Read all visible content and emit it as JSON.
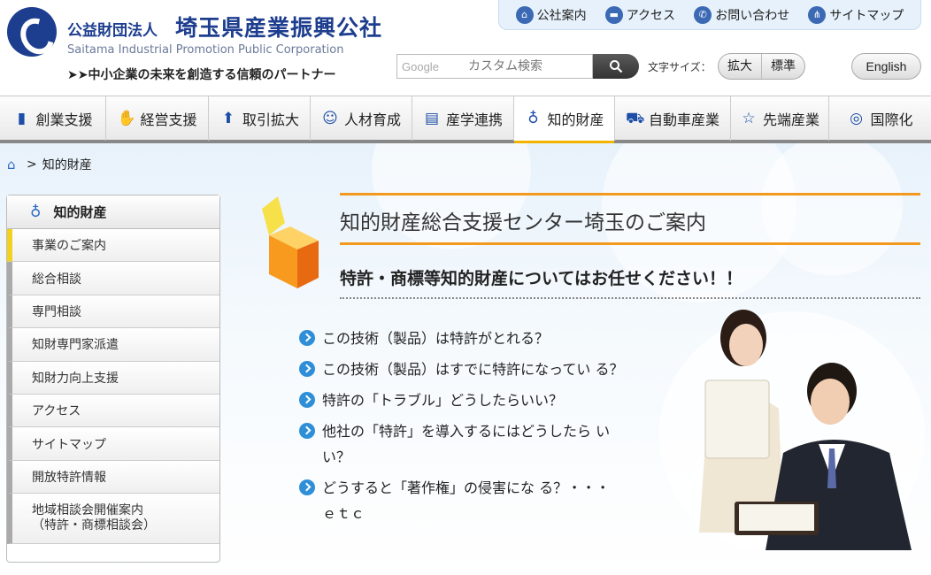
{
  "header": {
    "org_prefix": "公益財団法人",
    "org_name": "埼玉県産業振興公社",
    "org_en": "Saitama Industrial Promotion Public Corporation",
    "tagline": "➤➤中小企業の未来を創造する信頼のパートナー",
    "top_links": [
      {
        "label": "公社案内",
        "icon": "building-icon"
      },
      {
        "label": "アクセス",
        "icon": "car-icon"
      },
      {
        "label": "お問い合わせ",
        "icon": "phone-icon"
      },
      {
        "label": "サイトマップ",
        "icon": "sitemap-icon"
      }
    ],
    "search": {
      "brand": "Google",
      "placeholder": "カスタム検索"
    },
    "fontsize": {
      "label": "文字サイズ：",
      "larger": "拡大",
      "standard": "標準"
    },
    "english": "English"
  },
  "mainnav": {
    "items": [
      {
        "label": "創業支援",
        "icon": "door-icon"
      },
      {
        "label": "経営支援",
        "icon": "handshake-icon"
      },
      {
        "label": "取引拡大",
        "icon": "up-arrow-circle-icon"
      },
      {
        "label": "人材育成",
        "icon": "person-icon"
      },
      {
        "label": "産学連携",
        "icon": "book-icon"
      },
      {
        "label": "知的財産",
        "icon": "lightbulb-icon"
      },
      {
        "label": "自動車産業",
        "icon": "car-icon"
      },
      {
        "label": "先端産業",
        "icon": "star-icon"
      },
      {
        "label": "国際化",
        "icon": "globe-icon"
      }
    ],
    "active_index": 5
  },
  "breadcrumb": {
    "current": "知的財産",
    "separator": ">"
  },
  "sidebar": {
    "heading": "知的財産",
    "items": [
      {
        "label": "事業のご案内"
      },
      {
        "label": "総合相談"
      },
      {
        "label": "専門相談"
      },
      {
        "label": "知財専門家派遣"
      },
      {
        "label": "知財力向上支援"
      },
      {
        "label": "アクセス"
      },
      {
        "label": "サイトマップ"
      },
      {
        "label": "開放特許情報"
      },
      {
        "label": "地域相談会開催案内\n（特許・商標相談会）"
      }
    ]
  },
  "main": {
    "title": "知的財産総合支援センター埼玉のご案内",
    "subtitle": "特許・商標等知的財産についてはお任せください！！",
    "questions": [
      "この技術（製品）は特許がとれる？",
      "この技術（製品）はすでに特許になってい る？",
      "特許の「トラブル」どうしたらいい？",
      "他社の「特許」を導入するにはどうしたら いい？",
      "どうすると「著作権」の侵害にな る？・・・　ｅｔｃ"
    ]
  },
  "colors": {
    "brand_blue": "#1d3d8f",
    "accent_orange": "#f39a1e",
    "active_yellow": "#f2b400",
    "bullet_blue": "#2e8fd8"
  }
}
